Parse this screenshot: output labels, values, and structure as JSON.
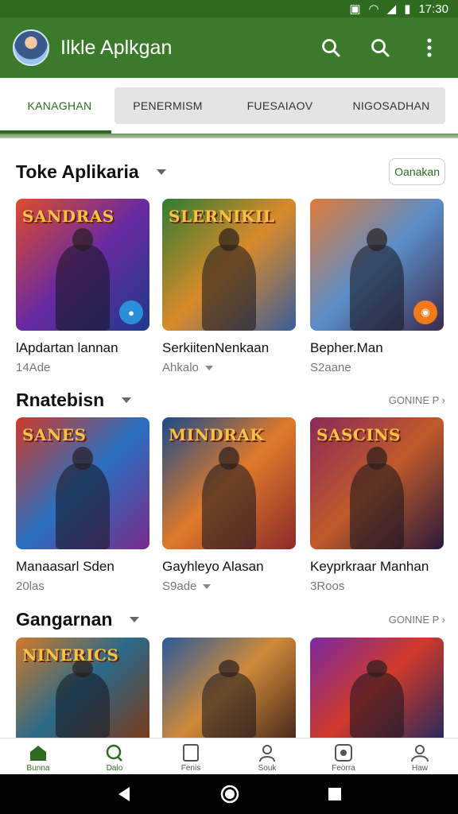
{
  "status": {
    "time": "17:30"
  },
  "appbar": {
    "title": "Ilkle Aplkgan",
    "search_icon": "search-icon",
    "search2_icon": "search-icon",
    "menu_icon": "more-vert-icon"
  },
  "tabs": [
    {
      "label": "KANAGHAN",
      "active": true
    },
    {
      "label": "PENERMISM",
      "active": false
    },
    {
      "label": "FUESAIAOV",
      "active": false
    },
    {
      "label": "NIGOSADHAN",
      "active": false
    }
  ],
  "sections": [
    {
      "title": "Toke Aplikaria",
      "action": "Oanakan",
      "cards": [
        {
          "title": "lApdartan lannan",
          "sub": "14Ade",
          "logo": "SANDRAS",
          "badge": "speech-icon",
          "badge_color": "#2a8fd8",
          "colors": [
            "#e14a2c",
            "#6a2aa0",
            "#1f3a8a"
          ]
        },
        {
          "title": "SerkiitenNenkaan",
          "sub": "Ahkalo",
          "logo": "SLERNIKIL",
          "colors": [
            "#2f7c33",
            "#d98a2a",
            "#3a5e9a"
          ]
        },
        {
          "title": "Bepher.Man",
          "sub": "S2aane",
          "badge": "face-icon",
          "badge_color": "#f07a1a",
          "colors": [
            "#e07a3a",
            "#5b8ec9",
            "#3b2a4a"
          ]
        }
      ]
    },
    {
      "title": "Rnatebisn",
      "action": "GONINE P",
      "cards": [
        {
          "title": "Manaasarl Sden",
          "sub": "20las",
          "logo": "SANES",
          "colors": [
            "#d03a2a",
            "#2a70c0",
            "#7a2a8a"
          ]
        },
        {
          "title": "Gayhleyo Alasan",
          "sub": "S9ade",
          "logo": "MINDRAK",
          "colors": [
            "#1a4a8a",
            "#e07a2a",
            "#8a2a2a"
          ]
        },
        {
          "title": "Keyprkraar Manhan",
          "sub": "3Roos",
          "logo": "SASCINS",
          "colors": [
            "#8a2a5a",
            "#c05a2a",
            "#2a1a3a"
          ]
        }
      ]
    },
    {
      "title": "Gangarnan",
      "action": "GONINE P",
      "cards": [
        {
          "title": "",
          "sub": "",
          "logo": "NINERICS",
          "colors": [
            "#d07a2a",
            "#2a6a8a",
            "#7a3a1a"
          ]
        },
        {
          "title": "",
          "sub": "",
          "logo": "",
          "colors": [
            "#2a5a9a",
            "#d08a3a",
            "#4a2a1a"
          ]
        },
        {
          "title": "",
          "sub": "",
          "logo": "",
          "colors": [
            "#7a2aa0",
            "#d03a2a",
            "#2a2a5a"
          ]
        }
      ]
    }
  ],
  "bottom_nav": [
    {
      "label": "Bunna",
      "icon": "home-icon",
      "active": true
    },
    {
      "label": "Dalo",
      "icon": "search-icon",
      "active": true
    },
    {
      "label": "Fenis",
      "icon": "square-icon",
      "active": false
    },
    {
      "label": "Souk",
      "icon": "person-icon",
      "active": false
    },
    {
      "label": "Feorra",
      "icon": "apps-icon",
      "active": false
    },
    {
      "label": "Haw",
      "icon": "account-icon",
      "active": false
    }
  ],
  "colors": {
    "primary": "#3a7a2a",
    "primary_dark": "#2e6b1f"
  }
}
